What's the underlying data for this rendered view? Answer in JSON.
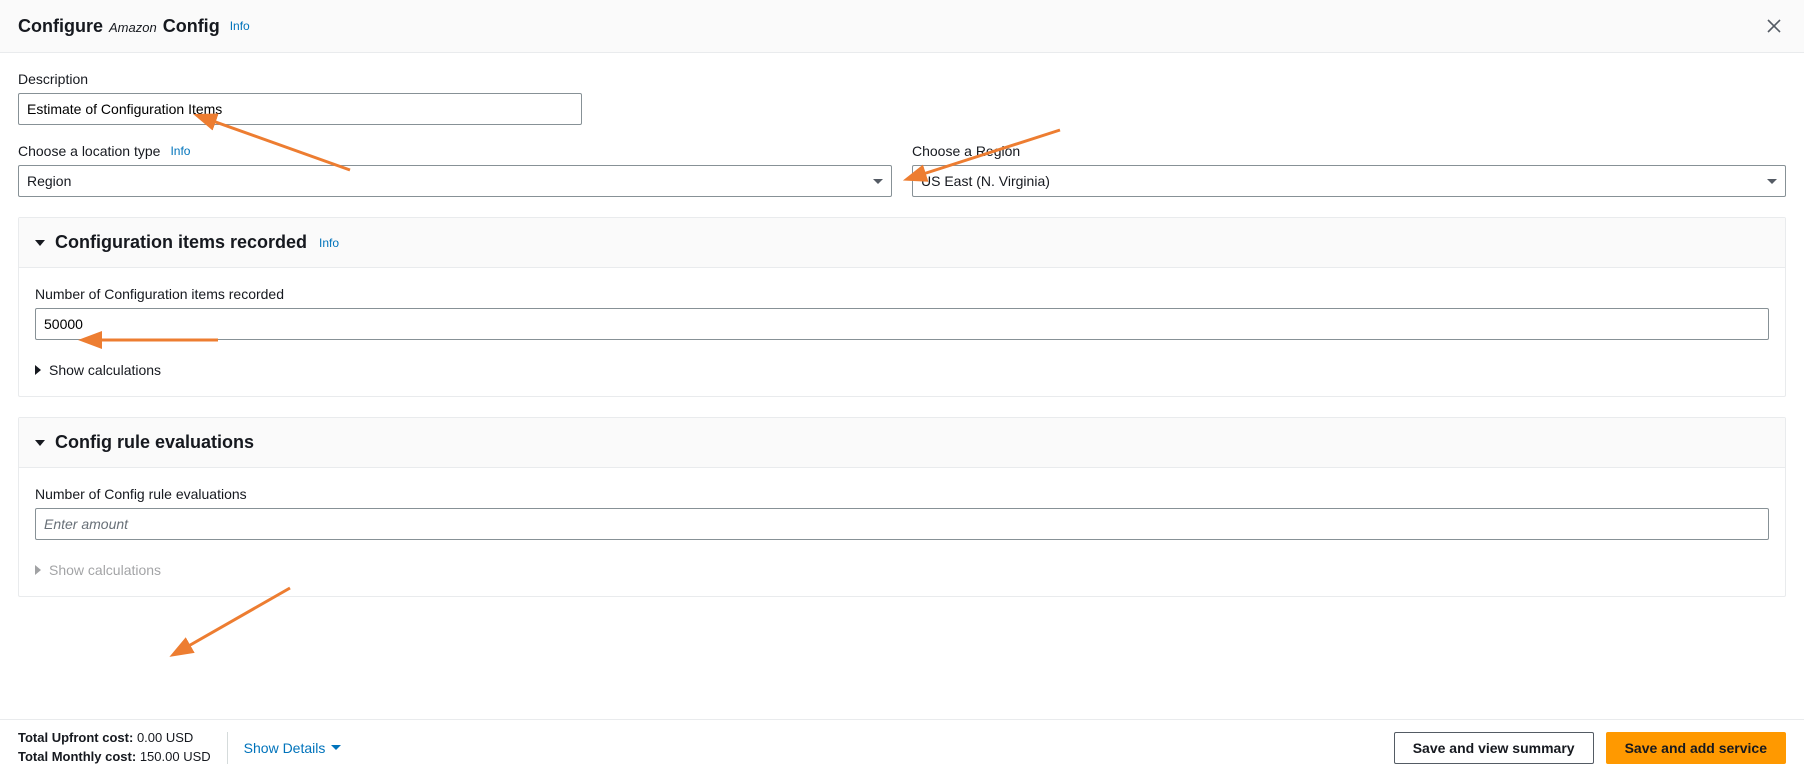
{
  "header": {
    "title_prefix": "Configure",
    "title_brand": "Amazon",
    "title_suffix": "Config",
    "info": "Info"
  },
  "description": {
    "label": "Description",
    "value": "Estimate of Configuration Items"
  },
  "location_type": {
    "label": "Choose a location type",
    "info": "Info",
    "value": "Region"
  },
  "region": {
    "label": "Choose a Region",
    "value": "US East (N. Virginia)"
  },
  "section_items": {
    "title": "Configuration items recorded",
    "info": "Info",
    "num_label": "Number of Configuration items recorded",
    "num_value": "50000",
    "show_calc": "Show calculations"
  },
  "section_rules": {
    "title": "Config rule evaluations",
    "num_label": "Number of Config rule evaluations",
    "num_placeholder": "Enter amount",
    "show_calc": "Show calculations"
  },
  "footer": {
    "upfront_label": "Total Upfront cost:",
    "upfront_value": "0.00 USD",
    "monthly_label": "Total Monthly cost:",
    "monthly_value": "150.00 USD",
    "show_details": "Show Details",
    "save_view": "Save and view summary",
    "save_add": "Save and add service"
  }
}
